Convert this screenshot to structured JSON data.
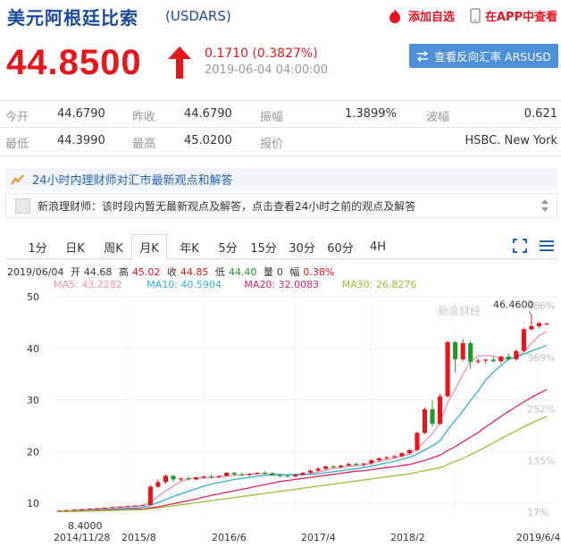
{
  "header": {
    "title": "美元阿根廷比索",
    "code": "(USDARS)",
    "add_favorite": "添加自选",
    "app_view": "在APP中查看"
  },
  "quote": {
    "price": "44.8500",
    "change": "0.1710 (0.3827%)",
    "timestamp": "2019-06-04 04:00:00",
    "reverse_button": "查看反向汇率 ARSUSD",
    "direction": "up"
  },
  "stats": {
    "open_label": "今开",
    "open": "44.6790",
    "prev_close_label": "昨收",
    "prev_close": "44.6790",
    "amplitude_label": "振幅",
    "amplitude": "1.3899%",
    "volatility_label": "波幅",
    "volatility": "0.621",
    "low_label": "最低",
    "low": "44.3990",
    "high_label": "最高",
    "high": "45.0200",
    "quote_label": "报价",
    "quote_source": "HSBC. New York"
  },
  "advisor": {
    "heading": "24小时内理财师对汇市最新观点和解答",
    "message": "新浪理财师：该时段内暂无最新观点及解答，点击查看24小时之前的观点及解答"
  },
  "tabs": [
    "1分",
    "日K",
    "周K",
    "月K",
    "年K",
    "5分",
    "15分",
    "30分",
    "60分",
    "4H"
  ],
  "active_tab": "月K",
  "ohlc": {
    "date": "2019/06/04",
    "open_label": "开",
    "open": "44.68",
    "high_label": "高",
    "high": "45.02",
    "close_label": "收",
    "close": "44.85",
    "low_label": "低",
    "low": "44.40",
    "vol_label": "量",
    "vol": "0",
    "amp_label": "幅",
    "amp": "0.38%"
  },
  "ma": {
    "ma5": "MA5: 43.2282",
    "ma10": "MA10: 40.5904",
    "ma20": "MA20: 32.0083",
    "ma30": "MA30: 26.8276"
  },
  "colors": {
    "up": "#e8161b",
    "down": "#1a9c2b",
    "ma5": "#ef8fb6",
    "ma10": "#2fb0d8",
    "ma20": "#e0245e",
    "ma30": "#9ac02f",
    "accent": "#1a4a9c"
  },
  "chart_data": {
    "type": "line",
    "title": "",
    "ylim": [
      8,
      52
    ],
    "y_ticks": [
      "50",
      "40",
      "30",
      "20",
      "10"
    ],
    "right_ticks": [
      "486%",
      "369%",
      "252%",
      "135%",
      "17%"
    ],
    "x_ticks": [
      "2014/11/28",
      "2015/8",
      "2016/6",
      "2017/4",
      "2018/2",
      "2019/6/4"
    ],
    "max_label": "46.4600",
    "min_label": "8.4000",
    "watermark": "新浪财经",
    "candles": [
      {
        "o": 8.4,
        "h": 8.6,
        "l": 8.4,
        "c": 8.55
      },
      {
        "o": 8.55,
        "h": 8.7,
        "l": 8.5,
        "c": 8.65
      },
      {
        "o": 8.65,
        "h": 8.8,
        "l": 8.6,
        "c": 8.75
      },
      {
        "o": 8.75,
        "h": 8.9,
        "l": 8.7,
        "c": 8.85
      },
      {
        "o": 8.85,
        "h": 9.0,
        "l": 8.8,
        "c": 8.95
      },
      {
        "o": 8.95,
        "h": 9.1,
        "l": 8.9,
        "c": 9.05
      },
      {
        "o": 9.05,
        "h": 9.2,
        "l": 9.0,
        "c": 9.15
      },
      {
        "o": 9.15,
        "h": 9.3,
        "l": 9.1,
        "c": 9.25
      },
      {
        "o": 9.25,
        "h": 9.4,
        "l": 9.2,
        "c": 9.35
      },
      {
        "o": 9.35,
        "h": 9.5,
        "l": 9.3,
        "c": 9.45
      },
      {
        "o": 9.45,
        "h": 9.6,
        "l": 9.4,
        "c": 9.55
      },
      {
        "o": 9.55,
        "h": 9.7,
        "l": 9.5,
        "c": 9.65
      },
      {
        "o": 9.65,
        "h": 13.5,
        "l": 9.6,
        "c": 13.2
      },
      {
        "o": 13.2,
        "h": 14.6,
        "l": 12.9,
        "c": 14.1
      },
      {
        "o": 14.1,
        "h": 15.6,
        "l": 13.8,
        "c": 15.3
      },
      {
        "o": 15.3,
        "h": 15.5,
        "l": 14.1,
        "c": 14.6
      },
      {
        "o": 14.6,
        "h": 15.0,
        "l": 14.3,
        "c": 14.8
      },
      {
        "o": 14.8,
        "h": 15.2,
        "l": 14.4,
        "c": 14.6
      },
      {
        "o": 14.6,
        "h": 15.1,
        "l": 14.5,
        "c": 15.0
      },
      {
        "o": 15.0,
        "h": 15.3,
        "l": 14.8,
        "c": 15.2
      },
      {
        "o": 15.2,
        "h": 15.5,
        "l": 14.9,
        "c": 15.1
      },
      {
        "o": 15.1,
        "h": 15.4,
        "l": 14.8,
        "c": 15.3
      },
      {
        "o": 15.3,
        "h": 16.0,
        "l": 15.1,
        "c": 15.9
      },
      {
        "o": 15.9,
        "h": 16.1,
        "l": 15.3,
        "c": 15.6
      },
      {
        "o": 15.6,
        "h": 15.9,
        "l": 15.2,
        "c": 15.5
      },
      {
        "o": 15.5,
        "h": 15.8,
        "l": 15.2,
        "c": 15.7
      },
      {
        "o": 15.7,
        "h": 16.0,
        "l": 15.5,
        "c": 15.9
      },
      {
        "o": 15.9,
        "h": 16.2,
        "l": 15.6,
        "c": 15.8
      },
      {
        "o": 15.8,
        "h": 16.0,
        "l": 15.3,
        "c": 15.4
      },
      {
        "o": 15.4,
        "h": 15.7,
        "l": 15.0,
        "c": 15.3
      },
      {
        "o": 15.3,
        "h": 15.5,
        "l": 15.0,
        "c": 15.2
      },
      {
        "o": 15.2,
        "h": 15.6,
        "l": 15.0,
        "c": 15.5
      },
      {
        "o": 15.5,
        "h": 16.0,
        "l": 15.3,
        "c": 15.9
      },
      {
        "o": 15.9,
        "h": 16.5,
        "l": 15.6,
        "c": 16.3
      },
      {
        "o": 16.3,
        "h": 16.9,
        "l": 16.1,
        "c": 16.7
      },
      {
        "o": 16.7,
        "h": 17.3,
        "l": 16.4,
        "c": 17.1
      },
      {
        "o": 17.1,
        "h": 17.5,
        "l": 16.8,
        "c": 17.0
      },
      {
        "o": 17.0,
        "h": 17.4,
        "l": 16.7,
        "c": 17.3
      },
      {
        "o": 17.3,
        "h": 17.9,
        "l": 17.0,
        "c": 17.6
      },
      {
        "o": 17.6,
        "h": 17.9,
        "l": 17.2,
        "c": 17.5
      },
      {
        "o": 17.5,
        "h": 17.8,
        "l": 17.1,
        "c": 17.7
      },
      {
        "o": 17.7,
        "h": 18.5,
        "l": 17.4,
        "c": 18.3
      },
      {
        "o": 18.3,
        "h": 18.9,
        "l": 18.0,
        "c": 18.7
      },
      {
        "o": 18.7,
        "h": 19.1,
        "l": 18.4,
        "c": 18.9
      },
      {
        "o": 18.9,
        "h": 19.3,
        "l": 18.6,
        "c": 19.1
      },
      {
        "o": 19.1,
        "h": 19.9,
        "l": 18.9,
        "c": 19.7
      },
      {
        "o": 19.7,
        "h": 20.5,
        "l": 19.5,
        "c": 20.3
      },
      {
        "o": 20.3,
        "h": 23.9,
        "l": 20.1,
        "c": 23.6
      },
      {
        "o": 23.6,
        "h": 28.6,
        "l": 23.4,
        "c": 28.2
      },
      {
        "o": 28.2,
        "h": 29.9,
        "l": 24.8,
        "c": 25.4
      },
      {
        "o": 25.4,
        "h": 31.2,
        "l": 25.1,
        "c": 30.7
      },
      {
        "o": 30.7,
        "h": 41.5,
        "l": 30.5,
        "c": 41.2
      },
      {
        "o": 41.2,
        "h": 41.4,
        "l": 35.3,
        "c": 37.9
      },
      {
        "o": 37.9,
        "h": 41.8,
        "l": 37.5,
        "c": 41.0
      },
      {
        "o": 41.0,
        "h": 41.5,
        "l": 36.0,
        "c": 37.4
      },
      {
        "o": 37.4,
        "h": 38.1,
        "l": 37.0,
        "c": 37.6
      },
      {
        "o": 37.6,
        "h": 38.0,
        "l": 37.1,
        "c": 37.8
      },
      {
        "o": 37.8,
        "h": 38.3,
        "l": 37.3,
        "c": 37.5
      },
      {
        "o": 37.5,
        "h": 38.6,
        "l": 37.2,
        "c": 38.4
      },
      {
        "o": 38.4,
        "h": 39.0,
        "l": 37.6,
        "c": 37.9
      },
      {
        "o": 37.9,
        "h": 39.8,
        "l": 37.6,
        "c": 39.5
      },
      {
        "o": 39.5,
        "h": 44.0,
        "l": 39.3,
        "c": 43.7
      },
      {
        "o": 43.7,
        "h": 46.46,
        "l": 43.4,
        "c": 44.3
      },
      {
        "o": 44.3,
        "h": 45.1,
        "l": 43.9,
        "c": 44.9
      },
      {
        "o": 44.68,
        "h": 45.02,
        "l": 44.4,
        "c": 44.85
      }
    ],
    "series": [
      {
        "name": "MA5",
        "values": [
          8.4,
          8.5,
          8.6,
          8.7,
          8.8,
          8.9,
          9.0,
          9.1,
          9.2,
          9.3,
          9.4,
          9.5,
          10.3,
          11.3,
          12.4,
          13.3,
          14.2,
          14.7,
          14.9,
          14.9,
          14.9,
          15.1,
          15.3,
          15.4,
          15.5,
          15.6,
          15.7,
          15.7,
          15.7,
          15.6,
          15.5,
          15.5,
          15.5,
          15.7,
          16.0,
          16.4,
          16.7,
          16.9,
          17.2,
          17.3,
          17.4,
          17.8,
          18.1,
          18.4,
          18.7,
          19.1,
          19.5,
          20.5,
          22.0,
          23.5,
          25.6,
          29.5,
          32.0,
          35.0,
          37.5,
          38.5,
          38.6,
          38.5,
          38.1,
          37.9,
          38.3,
          39.3,
          41.0,
          42.5,
          43.2
        ]
      },
      {
        "name": "MA10",
        "values": [
          8.4,
          8.45,
          8.5,
          8.55,
          8.65,
          8.7,
          8.8,
          8.85,
          8.95,
          9.05,
          9.1,
          9.2,
          9.6,
          10.1,
          10.7,
          11.3,
          11.8,
          12.3,
          12.8,
          13.3,
          13.7,
          14.0,
          14.3,
          14.6,
          14.8,
          15.0,
          15.2,
          15.4,
          15.5,
          15.5,
          15.5,
          15.6,
          15.6,
          15.6,
          15.7,
          15.9,
          16.1,
          16.3,
          16.5,
          16.7,
          16.9,
          17.2,
          17.5,
          17.8,
          18.1,
          18.5,
          18.9,
          19.5,
          20.3,
          21.1,
          22.1,
          24.2,
          26.0,
          27.9,
          29.9,
          31.7,
          33.9,
          35.4,
          36.7,
          37.9,
          38.3,
          38.9,
          39.5,
          40.0,
          40.6
        ]
      },
      {
        "name": "MA20",
        "values": [
          8.4,
          8.4,
          8.45,
          8.5,
          8.55,
          8.6,
          8.65,
          8.7,
          8.75,
          8.8,
          8.85,
          8.9,
          9.1,
          9.3,
          9.6,
          9.9,
          10.2,
          10.5,
          10.8,
          11.2,
          11.5,
          11.8,
          12.1,
          12.4,
          12.7,
          13.0,
          13.3,
          13.6,
          13.9,
          14.2,
          14.4,
          14.6,
          14.8,
          15.0,
          15.2,
          15.4,
          15.6,
          15.8,
          16.0,
          16.2,
          16.3,
          16.5,
          16.7,
          16.9,
          17.1,
          17.3,
          17.5,
          17.9,
          18.3,
          18.8,
          19.3,
          20.2,
          21.0,
          21.9,
          22.8,
          23.7,
          24.8,
          25.8,
          26.8,
          27.8,
          28.7,
          29.6,
          30.5,
          31.3,
          32.0
        ]
      },
      {
        "name": "MA30",
        "values": [
          8.4,
          8.4,
          8.4,
          8.45,
          8.5,
          8.5,
          8.55,
          8.6,
          8.65,
          8.7,
          8.7,
          8.75,
          8.9,
          9.1,
          9.3,
          9.5,
          9.7,
          9.9,
          10.1,
          10.3,
          10.5,
          10.7,
          10.9,
          11.1,
          11.3,
          11.5,
          11.7,
          11.9,
          12.1,
          12.3,
          12.5,
          12.7,
          12.9,
          13.1,
          13.3,
          13.5,
          13.7,
          13.9,
          14.1,
          14.3,
          14.5,
          14.7,
          14.9,
          15.1,
          15.3,
          15.5,
          15.7,
          16.0,
          16.3,
          16.6,
          16.9,
          17.5,
          18.1,
          18.7,
          19.4,
          20.1,
          20.9,
          21.7,
          22.5,
          23.3,
          24.0,
          24.8,
          25.5,
          26.2,
          26.8
        ]
      }
    ]
  }
}
